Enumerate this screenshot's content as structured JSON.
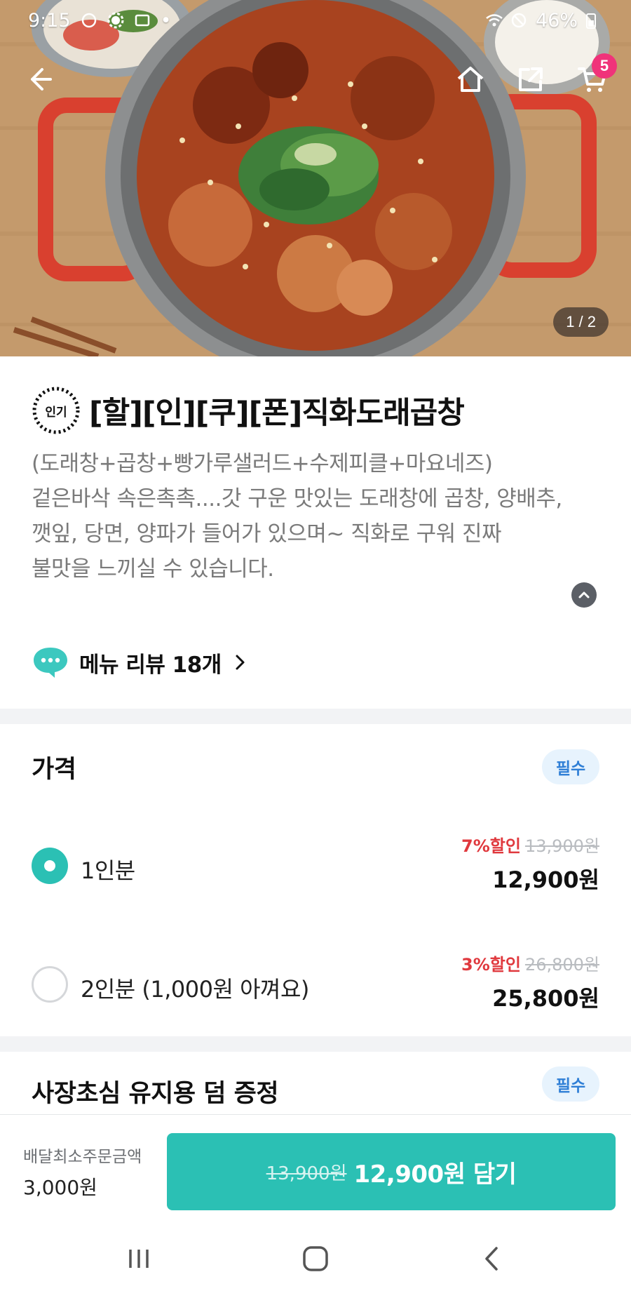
{
  "status_bar": {
    "time": "9:15",
    "battery": "46%"
  },
  "hero": {
    "image_label": "food-photo",
    "page_indicator": "1 / 2",
    "cart_count": "5"
  },
  "menu": {
    "popular_badge": "인기",
    "title": "[할][인][쿠][폰]직화도래곱창",
    "description": [
      "(도래창+곱창+빵가루샐러드+수제피클+마요네즈)",
      "겉은바삭 속은촉촉....갓 구운 맛있는 도래창에 곱창, 양배추,",
      "깻잎, 당면, 양파가 들어가 있으며~ 직화로 구워 진짜",
      "불맛을 느끼실 수 있습니다."
    ],
    "review_label": "메뉴 리뷰 18개"
  },
  "price_section": {
    "title": "가격",
    "required_label": "필수",
    "options": [
      {
        "label": "1인분",
        "discount": "7%할인",
        "original": "13,900원",
        "final": "12,900원",
        "selected": true
      },
      {
        "label": "2인분 (1,000원 아껴요)",
        "discount": "3%할인",
        "original": "26,800원",
        "final": "25,800원",
        "selected": false
      }
    ]
  },
  "gift_section": {
    "title": "사장초심 유지용 덤 증정",
    "required_label": "필수"
  },
  "bottom_bar": {
    "min_order_label": "배달최소주문금액",
    "min_order_value": "3,000원",
    "add_original": "13,900원",
    "add_label": "12,900원 담기"
  },
  "colors": {
    "accent": "#2bc0b4",
    "discount": "#e0393e",
    "badge_bg": "#e7f3fd",
    "badge_text": "#2f7fd6",
    "cart_badge": "#f0337a"
  }
}
